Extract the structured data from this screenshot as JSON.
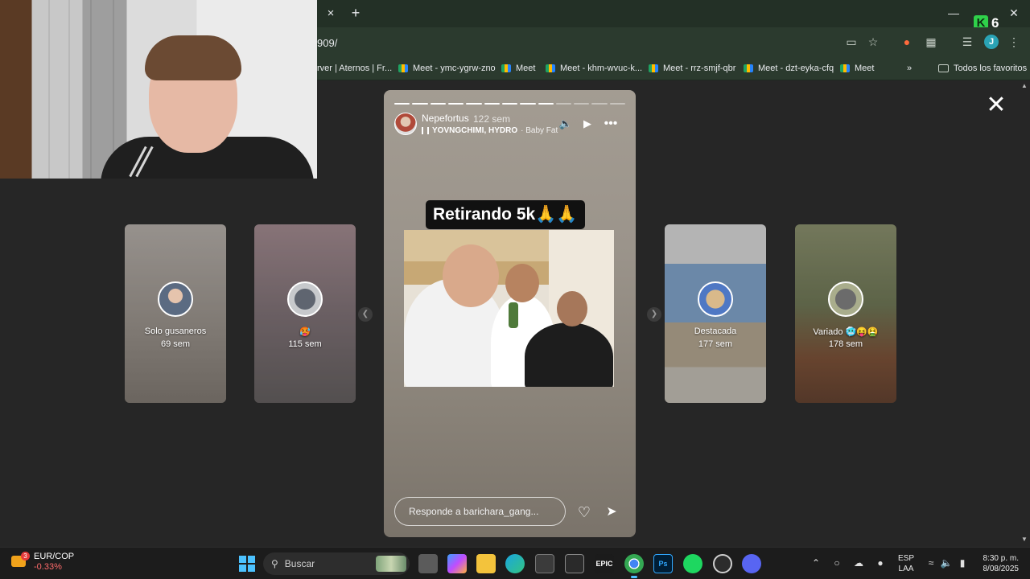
{
  "browser": {
    "url": "909/",
    "tab_close": "×",
    "new_tab": "+",
    "extension_count": "6",
    "profile_initial": "J",
    "bookmarks": [
      {
        "label": "rver | Aternos | Fr..."
      },
      {
        "label": "Meet - ymc-ygrw-zno"
      },
      {
        "label": "Meet"
      },
      {
        "label": "Meet - khm-wvuc-k..."
      },
      {
        "label": "Meet - rrz-smjf-qbr"
      },
      {
        "label": "Meet - dzt-eyka-cfq"
      },
      {
        "label": "Meet"
      }
    ],
    "bookmarks_overflow": "»",
    "all_bookmarks": "Todos los favoritos"
  },
  "story": {
    "username": "Nepefortus",
    "time_ago": "122 sem",
    "music_artists": "YOVNGCHIMI, HYDRO",
    "music_song": "· Baby Fat",
    "caption": "Retirando 5k🙏🙏",
    "reply_placeholder": "Responde a barichara_gang...",
    "progress_segments": 13,
    "progress_done": 9
  },
  "side_stories": [
    {
      "title": "Solo gusaneros",
      "time": "69 sem",
      "bg": "#b9b1aa"
    },
    {
      "title": "🥵",
      "time": "115 sem",
      "bg": "#9d8d8f"
    },
    {
      "title": "Destacada",
      "time": "177 sem",
      "bg": "#a8b6c8"
    },
    {
      "title": "Variado 🥶😝🤮",
      "time": "178 sem",
      "bg": "#8a8c6e"
    }
  ],
  "taskbar": {
    "widget_badge": "3",
    "widget_pair": "EUR/COP",
    "widget_change": "-0.33%",
    "search_label": "Buscar",
    "lang_line1": "ESP",
    "lang_line2": "LAA",
    "time": "8:30 p. m.",
    "date": "8/08/2025"
  }
}
